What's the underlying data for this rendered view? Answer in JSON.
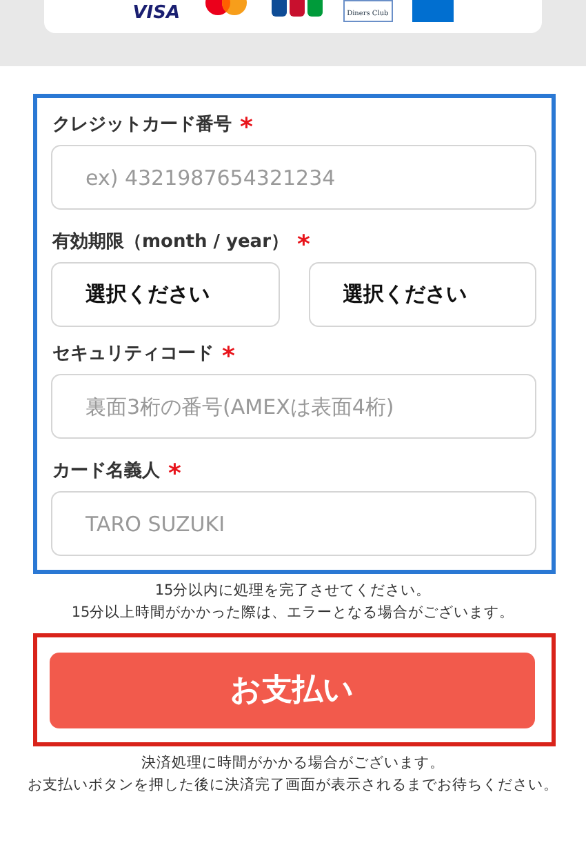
{
  "card_brands": [
    {
      "kind": "visa",
      "text": "VISA"
    },
    {
      "kind": "mastercard"
    },
    {
      "kind": "jcb"
    },
    {
      "kind": "diners",
      "text": "Diners Club"
    },
    {
      "kind": "amex"
    }
  ],
  "form": {
    "fields": [
      {
        "kind": "input",
        "label": "クレジットカード番号",
        "required": true,
        "placeholder": "ex) 4321987654321234"
      },
      {
        "kind": "selects",
        "label": "有効期限（month / year）",
        "required": true,
        "selects": [
          "選択ください",
          "選択ください"
        ]
      },
      {
        "kind": "input",
        "label": "セキュリティコード",
        "required": true,
        "placeholder": "裏面3桁の番号(AMEXは表面4桁)"
      },
      {
        "kind": "input",
        "label": "カード名義人",
        "required": true,
        "placeholder": "TARO SUZUKI"
      }
    ],
    "required_mark": "*"
  },
  "time_notes": [
    "15分以内に処理を完了させてください。",
    "15分以上時間がかかった際は、エラーとなる場合がございます。"
  ],
  "pay_button": "お支払い",
  "bottom_notes": [
    "決済処理に時間がかかる場合がございます。",
    "お支払いボタンを押した後に決済完了画面が表示されるまでお待ちください。"
  ]
}
